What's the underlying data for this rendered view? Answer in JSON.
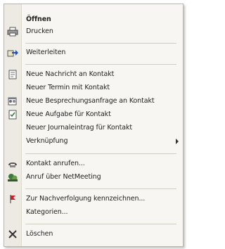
{
  "menu": {
    "items": [
      {
        "label": "Öffnen",
        "icon": "none"
      },
      {
        "label": "Drucken",
        "icon": "printer-icon"
      },
      {
        "label": "Weiterleiten",
        "icon": "forward-icon"
      },
      {
        "label": "Neue Nachricht an Kontakt",
        "icon": "new-message-icon"
      },
      {
        "label": "Neuer Termin mit Kontakt",
        "icon": "none"
      },
      {
        "label": "Neue Besprechungsanfrage an Kontakt",
        "icon": "meeting-request-icon"
      },
      {
        "label": "Neue Aufgabe für Kontakt",
        "icon": "task-icon"
      },
      {
        "label": "Neuer Journaleintrag für Kontakt",
        "icon": "none"
      },
      {
        "label": "Verknüpfung",
        "icon": "none",
        "submenu": true
      },
      {
        "label": "Kontakt anrufen...",
        "icon": "phone-icon"
      },
      {
        "label": "Anruf über NetMeeting",
        "icon": "netmeeting-icon"
      },
      {
        "label": "Zur Nachverfolgung kennzeichnen...",
        "icon": "flag-icon"
      },
      {
        "label": "Kategorien...",
        "icon": "none"
      },
      {
        "label": "Löschen",
        "icon": "delete-icon"
      }
    ]
  },
  "colors": {
    "menu_bg": "#f7f6f2",
    "gutter_bg": "#eceae2",
    "flag": "#c8202a",
    "text": "#222222"
  }
}
